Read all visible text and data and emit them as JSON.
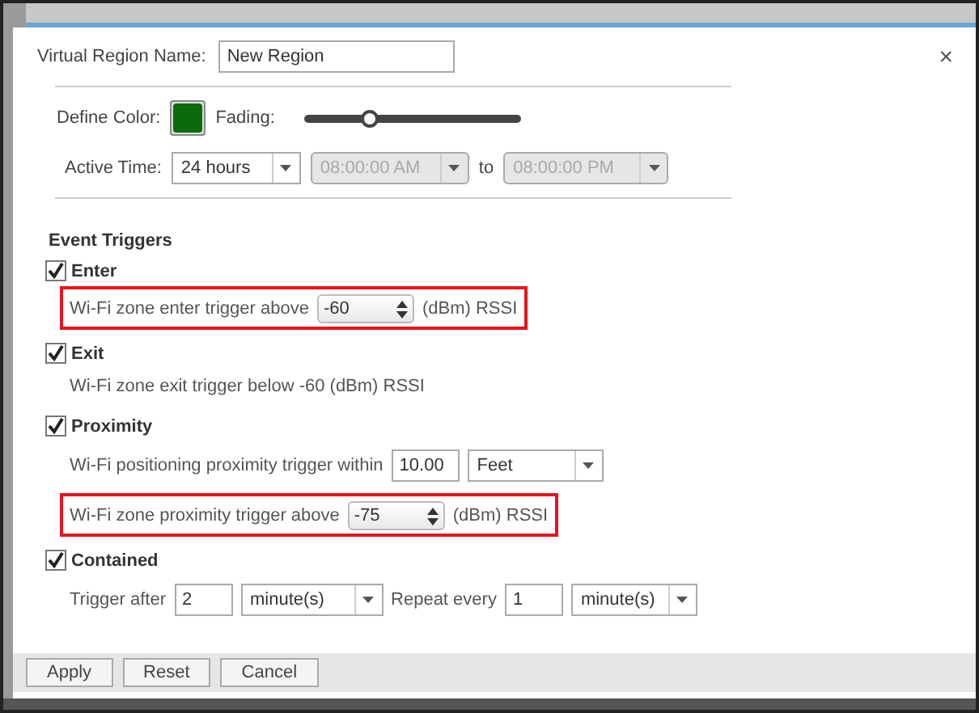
{
  "dialog": {
    "close": "×",
    "name_label": "Virtual Region Name:",
    "name_value": "New Region",
    "color_label": "Define Color:",
    "color": "#0b6b0b",
    "fading_label": "Fading:",
    "fading": {
      "level": 0.3
    },
    "active_time_label": "Active Time:",
    "active_time": "24 hours",
    "start_time": {
      "value": "08:00:00 AM",
      "disabled": true
    },
    "to_label": "to",
    "end_time": {
      "value": "08:00:00 PM",
      "disabled": true
    },
    "section_title": "Event Triggers",
    "triggers": [
      {
        "label": "Enter",
        "checked": true,
        "rows": [
          {
            "kind": "spin",
            "highlighted": true,
            "text": "Wi-Fi zone enter trigger above",
            "value": "-60",
            "unit": "(dBm) RSSI"
          }
        ]
      },
      {
        "label": "Exit",
        "checked": true,
        "rows": [
          {
            "kind": "note",
            "highlighted": false,
            "text": "Wi-Fi zone exit trigger below -60 (dBm) RSSI"
          }
        ]
      },
      {
        "label": "Proximity",
        "checked": true,
        "rows": [
          {
            "kind": "distance",
            "highlighted": false,
            "text": "Wi-Fi positioning proximity trigger within",
            "value": "10.00",
            "unit": "Feet"
          },
          {
            "kind": "spin",
            "highlighted": true,
            "text": "Wi-Fi zone proximity trigger above",
            "value": "-75",
            "unit": "(dBm) RSSI"
          }
        ]
      },
      {
        "label": "Contained",
        "checked": true,
        "rows": [
          {
            "kind": "timing",
            "highlighted": false,
            "text": "Trigger after",
            "value": "2",
            "unit": "minute(s)",
            "repeat_label": "Repeat every",
            "repeat_value": "1",
            "repeat_unit": "minute(s)"
          }
        ]
      }
    ],
    "buttons": [
      "Apply",
      "Reset",
      "Cancel"
    ]
  }
}
